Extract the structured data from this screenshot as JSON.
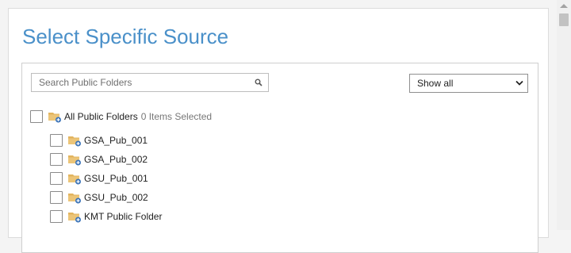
{
  "dialog": {
    "title": "Select Specific Source",
    "search": {
      "placeholder": "Search Public Folders",
      "value": ""
    },
    "filter": {
      "selected": "Show all"
    },
    "tree": {
      "root": {
        "label": "All Public Folders",
        "status": "0 Items Selected",
        "checked": false
      },
      "children": [
        {
          "label": "GSA_Pub_001",
          "checked": false
        },
        {
          "label": "GSA_Pub_002",
          "checked": false
        },
        {
          "label": "GSU_Pub_001",
          "checked": false
        },
        {
          "label": "GSU_Pub_002",
          "checked": false
        },
        {
          "label": "KMT Public Folder",
          "checked": false
        }
      ]
    }
  },
  "icons": {
    "search": "search-icon",
    "folder": "public-folder-icon",
    "dropdown": "chevron-down-icon"
  },
  "colors": {
    "title": "#4a90c9",
    "folder": "#e2b45e",
    "folder_badge": "#3a73b8"
  }
}
